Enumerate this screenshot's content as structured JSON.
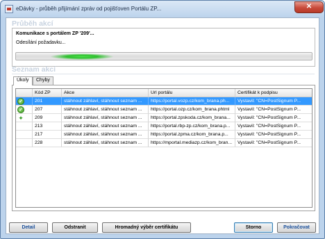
{
  "window": {
    "title": "eDávky - průběh přijímání zpráv od pojišťoven Portálu ZP...",
    "close_glyph": "✕"
  },
  "progress_section": {
    "title": "Průběh akcí",
    "task_title": "Komunikace s portálem ZP '209'...",
    "status": "Odesílání požadavku...",
    "bar_accent": "#2cc02c"
  },
  "actions_section": {
    "title": "Seznam akcí",
    "tabs": [
      {
        "label": "Úkoly",
        "active": true
      },
      {
        "label": "Chyby",
        "active": false
      }
    ],
    "columns": [
      "",
      "Kód ZP",
      "Akce",
      "Url portálu",
      "Certifikát k podpisu"
    ],
    "rows": [
      {
        "icon": "check-icon",
        "code": "201",
        "action": "stáhnout záhlaví, stáhnout seznam ...",
        "url": "https://portal.vozp.cz/kom_brana.ph...",
        "cert": "Vystavil: \"CN=PostSignum P...",
        "selected": true
      },
      {
        "icon": "check-icon",
        "code": "207",
        "action": "stáhnout záhlaví, stáhnout seznam ...",
        "url": "https://portal.ozp.cz/kom_brana.phtml",
        "cert": "Vystavil: \"CN=PostSignum P...",
        "selected": false
      },
      {
        "icon": "running-icon",
        "code": "209",
        "action": "stáhnout záhlaví, stáhnout seznam ...",
        "url": "https://portal.zpskoda.cz/kom_brana...",
        "cert": "Vystavil: \"CN=PostSignum P...",
        "selected": false
      },
      {
        "icon": "",
        "code": "213",
        "action": "stáhnout záhlaví, stáhnout seznam ...",
        "url": "https://portal.rbp-zp.cz/kom_brana.p...",
        "cert": "Vystavil: \"CN=PostSignum P...",
        "selected": false
      },
      {
        "icon": "",
        "code": "217",
        "action": "stáhnout záhlaví, stáhnout seznam ...",
        "url": "https://portal.zpma.cz/kom_brana.p...",
        "cert": "Vystavil: \"CN=PostSignum P...",
        "selected": false
      },
      {
        "icon": "",
        "code": "228",
        "action": "stáhnout záhlaví, stáhnout seznam ...",
        "url": "https://mportal.mediazp.cz/kom_bran...",
        "cert": "Vystavil: \"CN=PostSignum P...",
        "selected": false
      }
    ],
    "selection_color": "#3399ff"
  },
  "buttons": {
    "detail": "Detail",
    "remove": "Odstranit",
    "bulk_cert": "Hromadný výběr certifikátu",
    "cancel": "Storno",
    "continue": "Pokračovat"
  }
}
